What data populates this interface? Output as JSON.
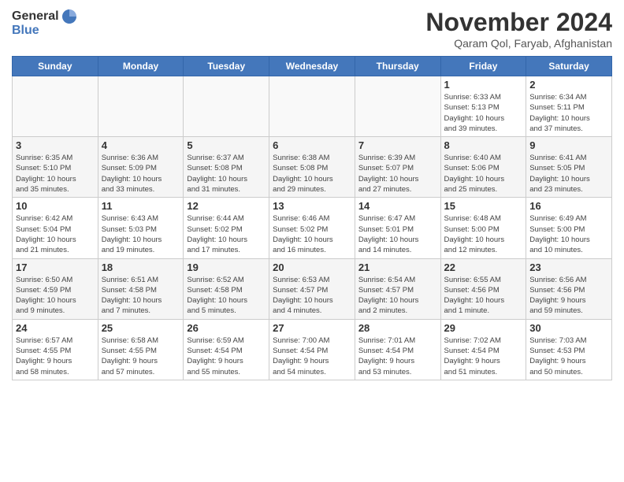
{
  "header": {
    "logo": {
      "general": "General",
      "blue": "Blue"
    },
    "title": "November 2024",
    "location": "Qaram Qol, Faryab, Afghanistan"
  },
  "calendar": {
    "weekdays": [
      "Sunday",
      "Monday",
      "Tuesday",
      "Wednesday",
      "Thursday",
      "Friday",
      "Saturday"
    ],
    "weeks": [
      [
        {
          "day": "",
          "info": ""
        },
        {
          "day": "",
          "info": ""
        },
        {
          "day": "",
          "info": ""
        },
        {
          "day": "",
          "info": ""
        },
        {
          "day": "",
          "info": ""
        },
        {
          "day": "1",
          "info": "Sunrise: 6:33 AM\nSunset: 5:13 PM\nDaylight: 10 hours\nand 39 minutes."
        },
        {
          "day": "2",
          "info": "Sunrise: 6:34 AM\nSunset: 5:11 PM\nDaylight: 10 hours\nand 37 minutes."
        }
      ],
      [
        {
          "day": "3",
          "info": "Sunrise: 6:35 AM\nSunset: 5:10 PM\nDaylight: 10 hours\nand 35 minutes."
        },
        {
          "day": "4",
          "info": "Sunrise: 6:36 AM\nSunset: 5:09 PM\nDaylight: 10 hours\nand 33 minutes."
        },
        {
          "day": "5",
          "info": "Sunrise: 6:37 AM\nSunset: 5:08 PM\nDaylight: 10 hours\nand 31 minutes."
        },
        {
          "day": "6",
          "info": "Sunrise: 6:38 AM\nSunset: 5:08 PM\nDaylight: 10 hours\nand 29 minutes."
        },
        {
          "day": "7",
          "info": "Sunrise: 6:39 AM\nSunset: 5:07 PM\nDaylight: 10 hours\nand 27 minutes."
        },
        {
          "day": "8",
          "info": "Sunrise: 6:40 AM\nSunset: 5:06 PM\nDaylight: 10 hours\nand 25 minutes."
        },
        {
          "day": "9",
          "info": "Sunrise: 6:41 AM\nSunset: 5:05 PM\nDaylight: 10 hours\nand 23 minutes."
        }
      ],
      [
        {
          "day": "10",
          "info": "Sunrise: 6:42 AM\nSunset: 5:04 PM\nDaylight: 10 hours\nand 21 minutes."
        },
        {
          "day": "11",
          "info": "Sunrise: 6:43 AM\nSunset: 5:03 PM\nDaylight: 10 hours\nand 19 minutes."
        },
        {
          "day": "12",
          "info": "Sunrise: 6:44 AM\nSunset: 5:02 PM\nDaylight: 10 hours\nand 17 minutes."
        },
        {
          "day": "13",
          "info": "Sunrise: 6:46 AM\nSunset: 5:02 PM\nDaylight: 10 hours\nand 16 minutes."
        },
        {
          "day": "14",
          "info": "Sunrise: 6:47 AM\nSunset: 5:01 PM\nDaylight: 10 hours\nand 14 minutes."
        },
        {
          "day": "15",
          "info": "Sunrise: 6:48 AM\nSunset: 5:00 PM\nDaylight: 10 hours\nand 12 minutes."
        },
        {
          "day": "16",
          "info": "Sunrise: 6:49 AM\nSunset: 5:00 PM\nDaylight: 10 hours\nand 10 minutes."
        }
      ],
      [
        {
          "day": "17",
          "info": "Sunrise: 6:50 AM\nSunset: 4:59 PM\nDaylight: 10 hours\nand 9 minutes."
        },
        {
          "day": "18",
          "info": "Sunrise: 6:51 AM\nSunset: 4:58 PM\nDaylight: 10 hours\nand 7 minutes."
        },
        {
          "day": "19",
          "info": "Sunrise: 6:52 AM\nSunset: 4:58 PM\nDaylight: 10 hours\nand 5 minutes."
        },
        {
          "day": "20",
          "info": "Sunrise: 6:53 AM\nSunset: 4:57 PM\nDaylight: 10 hours\nand 4 minutes."
        },
        {
          "day": "21",
          "info": "Sunrise: 6:54 AM\nSunset: 4:57 PM\nDaylight: 10 hours\nand 2 minutes."
        },
        {
          "day": "22",
          "info": "Sunrise: 6:55 AM\nSunset: 4:56 PM\nDaylight: 10 hours\nand 1 minute."
        },
        {
          "day": "23",
          "info": "Sunrise: 6:56 AM\nSunset: 4:56 PM\nDaylight: 9 hours\nand 59 minutes."
        }
      ],
      [
        {
          "day": "24",
          "info": "Sunrise: 6:57 AM\nSunset: 4:55 PM\nDaylight: 9 hours\nand 58 minutes."
        },
        {
          "day": "25",
          "info": "Sunrise: 6:58 AM\nSunset: 4:55 PM\nDaylight: 9 hours\nand 57 minutes."
        },
        {
          "day": "26",
          "info": "Sunrise: 6:59 AM\nSunset: 4:54 PM\nDaylight: 9 hours\nand 55 minutes."
        },
        {
          "day": "27",
          "info": "Sunrise: 7:00 AM\nSunset: 4:54 PM\nDaylight: 9 hours\nand 54 minutes."
        },
        {
          "day": "28",
          "info": "Sunrise: 7:01 AM\nSunset: 4:54 PM\nDaylight: 9 hours\nand 53 minutes."
        },
        {
          "day": "29",
          "info": "Sunrise: 7:02 AM\nSunset: 4:54 PM\nDaylight: 9 hours\nand 51 minutes."
        },
        {
          "day": "30",
          "info": "Sunrise: 7:03 AM\nSunset: 4:53 PM\nDaylight: 9 hours\nand 50 minutes."
        }
      ]
    ]
  }
}
